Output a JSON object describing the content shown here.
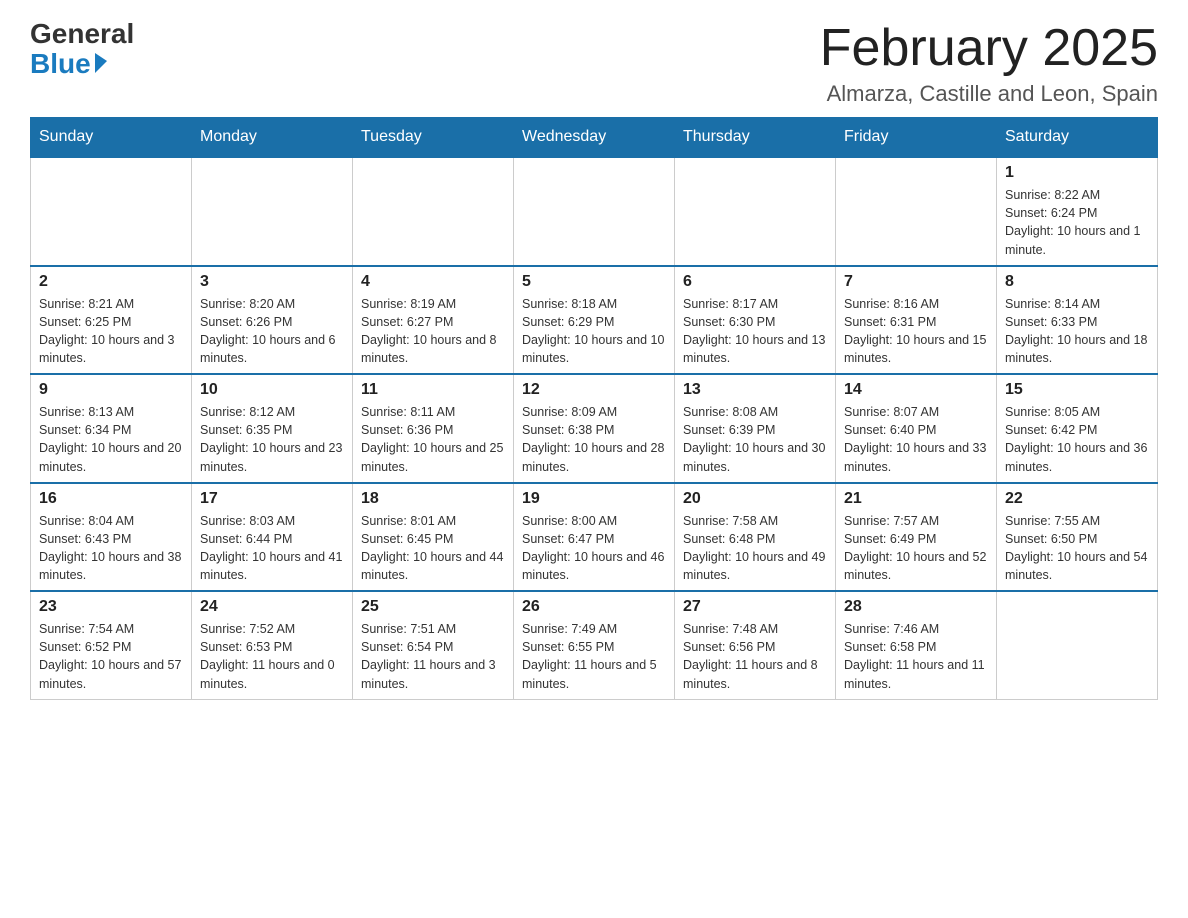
{
  "logo": {
    "general": "General",
    "blue": "Blue"
  },
  "title": "February 2025",
  "location": "Almarza, Castille and Leon, Spain",
  "weekdays": [
    "Sunday",
    "Monday",
    "Tuesday",
    "Wednesday",
    "Thursday",
    "Friday",
    "Saturday"
  ],
  "weeks": [
    [
      {
        "day": "",
        "info": ""
      },
      {
        "day": "",
        "info": ""
      },
      {
        "day": "",
        "info": ""
      },
      {
        "day": "",
        "info": ""
      },
      {
        "day": "",
        "info": ""
      },
      {
        "day": "",
        "info": ""
      },
      {
        "day": "1",
        "info": "Sunrise: 8:22 AM\nSunset: 6:24 PM\nDaylight: 10 hours and 1 minute."
      }
    ],
    [
      {
        "day": "2",
        "info": "Sunrise: 8:21 AM\nSunset: 6:25 PM\nDaylight: 10 hours and 3 minutes."
      },
      {
        "day": "3",
        "info": "Sunrise: 8:20 AM\nSunset: 6:26 PM\nDaylight: 10 hours and 6 minutes."
      },
      {
        "day": "4",
        "info": "Sunrise: 8:19 AM\nSunset: 6:27 PM\nDaylight: 10 hours and 8 minutes."
      },
      {
        "day": "5",
        "info": "Sunrise: 8:18 AM\nSunset: 6:29 PM\nDaylight: 10 hours and 10 minutes."
      },
      {
        "day": "6",
        "info": "Sunrise: 8:17 AM\nSunset: 6:30 PM\nDaylight: 10 hours and 13 minutes."
      },
      {
        "day": "7",
        "info": "Sunrise: 8:16 AM\nSunset: 6:31 PM\nDaylight: 10 hours and 15 minutes."
      },
      {
        "day": "8",
        "info": "Sunrise: 8:14 AM\nSunset: 6:33 PM\nDaylight: 10 hours and 18 minutes."
      }
    ],
    [
      {
        "day": "9",
        "info": "Sunrise: 8:13 AM\nSunset: 6:34 PM\nDaylight: 10 hours and 20 minutes."
      },
      {
        "day": "10",
        "info": "Sunrise: 8:12 AM\nSunset: 6:35 PM\nDaylight: 10 hours and 23 minutes."
      },
      {
        "day": "11",
        "info": "Sunrise: 8:11 AM\nSunset: 6:36 PM\nDaylight: 10 hours and 25 minutes."
      },
      {
        "day": "12",
        "info": "Sunrise: 8:09 AM\nSunset: 6:38 PM\nDaylight: 10 hours and 28 minutes."
      },
      {
        "day": "13",
        "info": "Sunrise: 8:08 AM\nSunset: 6:39 PM\nDaylight: 10 hours and 30 minutes."
      },
      {
        "day": "14",
        "info": "Sunrise: 8:07 AM\nSunset: 6:40 PM\nDaylight: 10 hours and 33 minutes."
      },
      {
        "day": "15",
        "info": "Sunrise: 8:05 AM\nSunset: 6:42 PM\nDaylight: 10 hours and 36 minutes."
      }
    ],
    [
      {
        "day": "16",
        "info": "Sunrise: 8:04 AM\nSunset: 6:43 PM\nDaylight: 10 hours and 38 minutes."
      },
      {
        "day": "17",
        "info": "Sunrise: 8:03 AM\nSunset: 6:44 PM\nDaylight: 10 hours and 41 minutes."
      },
      {
        "day": "18",
        "info": "Sunrise: 8:01 AM\nSunset: 6:45 PM\nDaylight: 10 hours and 44 minutes."
      },
      {
        "day": "19",
        "info": "Sunrise: 8:00 AM\nSunset: 6:47 PM\nDaylight: 10 hours and 46 minutes."
      },
      {
        "day": "20",
        "info": "Sunrise: 7:58 AM\nSunset: 6:48 PM\nDaylight: 10 hours and 49 minutes."
      },
      {
        "day": "21",
        "info": "Sunrise: 7:57 AM\nSunset: 6:49 PM\nDaylight: 10 hours and 52 minutes."
      },
      {
        "day": "22",
        "info": "Sunrise: 7:55 AM\nSunset: 6:50 PM\nDaylight: 10 hours and 54 minutes."
      }
    ],
    [
      {
        "day": "23",
        "info": "Sunrise: 7:54 AM\nSunset: 6:52 PM\nDaylight: 10 hours and 57 minutes."
      },
      {
        "day": "24",
        "info": "Sunrise: 7:52 AM\nSunset: 6:53 PM\nDaylight: 11 hours and 0 minutes."
      },
      {
        "day": "25",
        "info": "Sunrise: 7:51 AM\nSunset: 6:54 PM\nDaylight: 11 hours and 3 minutes."
      },
      {
        "day": "26",
        "info": "Sunrise: 7:49 AM\nSunset: 6:55 PM\nDaylight: 11 hours and 5 minutes."
      },
      {
        "day": "27",
        "info": "Sunrise: 7:48 AM\nSunset: 6:56 PM\nDaylight: 11 hours and 8 minutes."
      },
      {
        "day": "28",
        "info": "Sunrise: 7:46 AM\nSunset: 6:58 PM\nDaylight: 11 hours and 11 minutes."
      },
      {
        "day": "",
        "info": ""
      }
    ]
  ]
}
